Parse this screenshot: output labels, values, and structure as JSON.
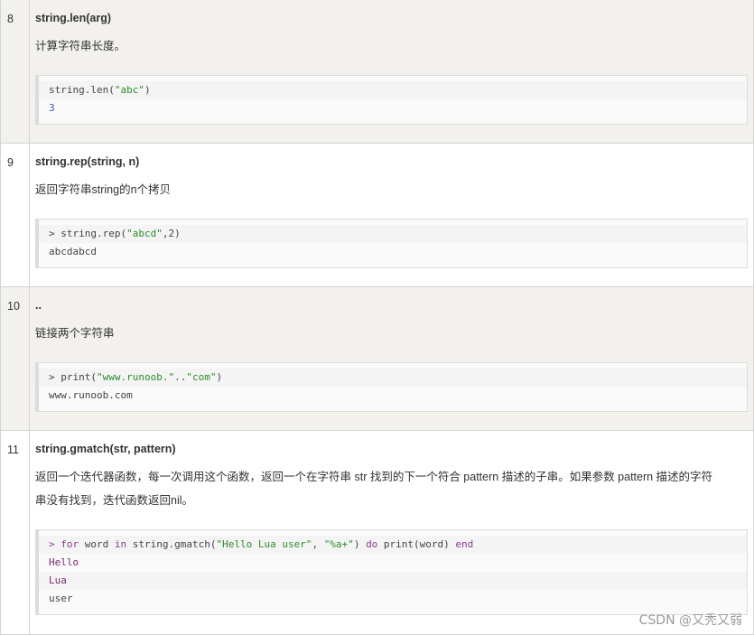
{
  "rows": [
    {
      "num": "8",
      "name": "string.len(arg)",
      "desc": "计算字符串长度。",
      "code": [
        {
          "pre": "string.len(",
          "str": "\"abc\"",
          "post": ")"
        },
        {
          "out": "3"
        }
      ]
    },
    {
      "num": "9",
      "name": "string.rep(string, n)",
      "desc": "返回字符串string的n个拷贝",
      "code": [
        {
          "pre": "> string.rep(",
          "str": "\"abcd\"",
          "post": ",2)"
        },
        {
          "out": "abcdabcd"
        }
      ]
    },
    {
      "num": "10",
      "name": "..",
      "desc": "链接两个字符串",
      "code": [
        {
          "pre": "> print(",
          "str": "\"www.runoob.\"",
          "mid": "..",
          "str2": "\"com\"",
          "post": ")"
        },
        {
          "out": "www.runoob.com"
        }
      ]
    },
    {
      "num": "11",
      "name": "string.gmatch(str, pattern)",
      "desc_lines": [
        "返回一个迭代器函数，每一次调用这个函数，返回一个在字符串 str 找到的下一个符合 pattern 描述的子串。如果参数 pattern 描述的字符",
        "串没有找到，迭代函数返回nil。"
      ],
      "code": [
        {
          "kw1": "> for",
          "p1": " word ",
          "kw2": "in",
          "p2": " string.gmatch(",
          "str": "\"Hello Lua user\"",
          "p3": ", ",
          "str2": "\"%a+\"",
          "p4": ") ",
          "kw3": "do",
          "p5": " print(word) ",
          "kw4": "end"
        },
        {
          "out": "Hello"
        },
        {
          "out": "Lua"
        },
        {
          "out": "user"
        }
      ]
    }
  ],
  "watermark": "CSDN @又秃又弱"
}
